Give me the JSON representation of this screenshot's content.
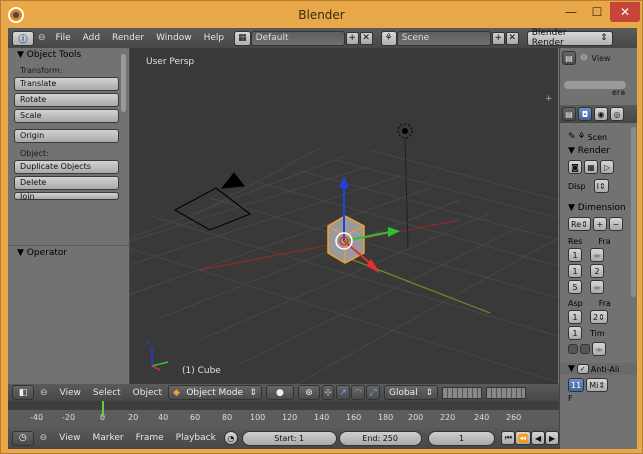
{
  "window": {
    "title": "Blender",
    "minimize": "—",
    "maximize": "☐",
    "close": "✕"
  },
  "info_header": {
    "menus": [
      "File",
      "Add",
      "Render",
      "Window",
      "Help"
    ],
    "layout": "Default",
    "scene": "Scene",
    "engine": "Blender Render"
  },
  "viewport": {
    "label": "User Persp",
    "object_label": "(1) Cube"
  },
  "tool_shelf": {
    "panel_title": "Object Tools",
    "transform_label": "Transform:",
    "transform_buttons": [
      "Translate",
      "Rotate",
      "Scale"
    ],
    "origin_button": "Origin",
    "object_label": "Object:",
    "object_buttons": [
      "Duplicate Objects",
      "Delete",
      "Join"
    ],
    "operator_title": "Operator"
  },
  "right_top": {
    "view_label": "View",
    "era_label": "era"
  },
  "properties": {
    "scene_label": "Scen",
    "render_title": "Render",
    "disp_label": "Disp",
    "disp_value": "I",
    "dimensions_title": "Dimension",
    "preset_label": "Re",
    "res_label": "Res",
    "fra_label": "Fra",
    "res_x": "1",
    "res_y": "1",
    "res_pct": "5",
    "fra_start": "1",
    "fra_end": "2",
    "asp_label": "Asp",
    "fra2_label": "Fra",
    "asp_x": "1",
    "asp_y": "1",
    "fps_value": "2",
    "tim_label": "Tim",
    "antialias_title": "Anti-Ali",
    "aa_value": "11",
    "aa_filter": "Mi",
    "f_label": "F"
  },
  "view_header": {
    "menus": [
      "View",
      "Select",
      "Object"
    ],
    "mode": "Object Mode",
    "orientation": "Global"
  },
  "timeline": {
    "ticks": [
      "-40",
      "-20",
      "0",
      "20",
      "40",
      "60",
      "80",
      "100",
      "120",
      "140",
      "160",
      "180",
      "200",
      "220",
      "240",
      "260"
    ],
    "current_frame_marker": 1
  },
  "timeline_header": {
    "menus": [
      "View",
      "Marker",
      "Frame",
      "Playback"
    ],
    "start": "Start: 1",
    "end": "End: 250",
    "current": "1"
  }
}
